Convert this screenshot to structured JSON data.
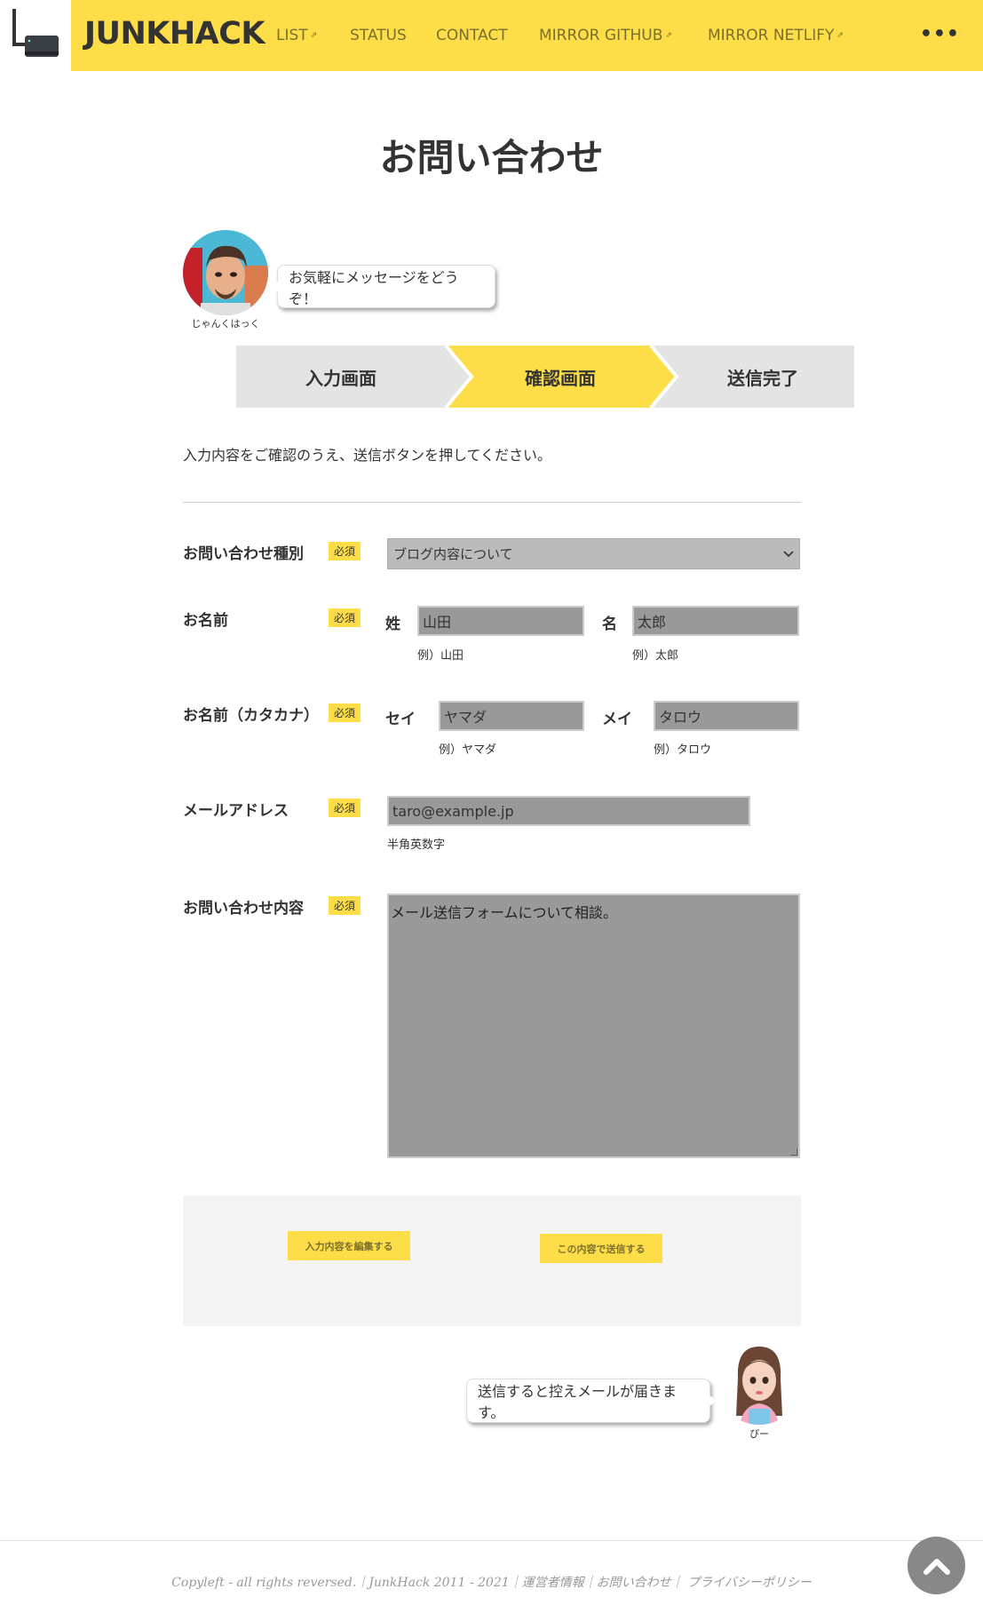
{
  "header": {
    "brand": "JUNKHACK",
    "nav": [
      {
        "label": "LIST",
        "external": true
      },
      {
        "label": "STATUS",
        "external": false
      },
      {
        "label": "CONTACT",
        "external": false
      },
      {
        "label": "MIRROR GITHUB",
        "external": true
      },
      {
        "label": "MIRROR NETLIFY",
        "external": true
      }
    ],
    "external_mark": "⇗",
    "more": "•••"
  },
  "page_title": "お問い合わせ",
  "intro": {
    "avatar_name": "じゃんくはっく",
    "message": "お気軽にメッセージをどうぞ！"
  },
  "steps": [
    {
      "label": "入力画面",
      "active": false
    },
    {
      "label": "確認画面",
      "active": true
    },
    {
      "label": "送信完了",
      "active": false
    }
  ],
  "instruction": "入力内容をご確認のうえ、送信ボタンを押してください。",
  "form": {
    "required_badge": "必須",
    "inquiry_type": {
      "label": "お問い合わせ種別",
      "value": "ブログ内容について"
    },
    "name": {
      "label": "お名前",
      "last_label": "姓",
      "last_value": "山田",
      "last_hint": "例）山田",
      "first_label": "名",
      "first_value": "太郎",
      "first_hint": "例）太郎"
    },
    "kana": {
      "label": "お名前（カタカナ）",
      "last_label": "セイ",
      "last_value": "ヤマダ",
      "last_hint": "例）ヤマダ",
      "first_label": "メイ",
      "first_value": "タロウ",
      "first_hint": "例）タロウ"
    },
    "email": {
      "label": "メールアドレス",
      "value": "taro@example.jp",
      "hint": "半角英数字"
    },
    "message": {
      "label": "お問い合わせ内容",
      "value": "メール送信フォームについて相談。"
    }
  },
  "actions": {
    "edit_label": "入力内容を編集する",
    "submit_label": "この内容で送信する"
  },
  "outro": {
    "avatar_name": "ぴー",
    "message": "送信すると控えメールが届きます。"
  },
  "footer": {
    "text": "Copyleft - all rights reversed.｜JunkHack 2011 - 2021｜運営者情報｜お問い合わせ｜ プライバシーポリシー"
  },
  "colors": {
    "accent": "#fdde48",
    "text": "#333333",
    "field_bg": "#999999",
    "panel_bg": "#f4f4f4"
  }
}
